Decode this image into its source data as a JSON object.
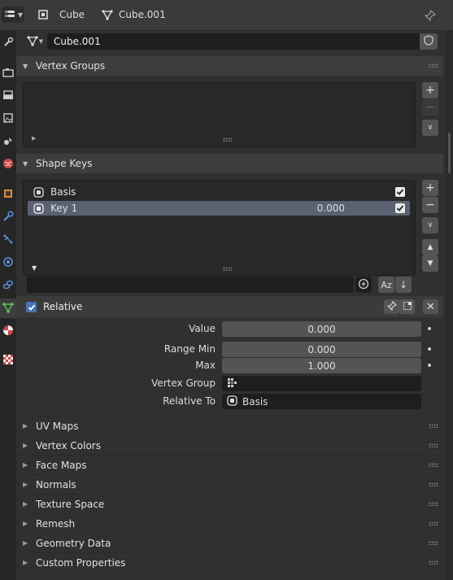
{
  "header": {
    "object_name": "Cube",
    "mesh_name": "Cube.001"
  },
  "mesh_selector": {
    "value": "Cube.001"
  },
  "vertex_groups": {
    "title": "Vertex Groups"
  },
  "shape_keys": {
    "title": "Shape Keys",
    "items": [
      {
        "name": "Basis",
        "value": "",
        "checked": true,
        "selected": false
      },
      {
        "name": "Key 1",
        "value": "0.000",
        "checked": true,
        "selected": true
      }
    ],
    "sort_label": "Az"
  },
  "relative": {
    "label": "Relative",
    "checked": true
  },
  "properties": {
    "value_label": "Value",
    "value": "0.000",
    "range_min_label": "Range Min",
    "range_min": "0.000",
    "max_label": "Max",
    "max": "1.000",
    "vertex_group_label": "Vertex Group",
    "vertex_group_value": "",
    "relative_to_label": "Relative To",
    "relative_to_value": "Basis"
  },
  "collapsed_panels": [
    "UV Maps",
    "Vertex Colors",
    "Face Maps",
    "Normals",
    "Texture Space",
    "Remesh",
    "Geometry Data",
    "Custom Properties"
  ],
  "colors": {
    "accent": "#4772b3",
    "selection": "#5a6272",
    "panel_bg": "#303030",
    "header_bg": "#3d3d3d"
  }
}
